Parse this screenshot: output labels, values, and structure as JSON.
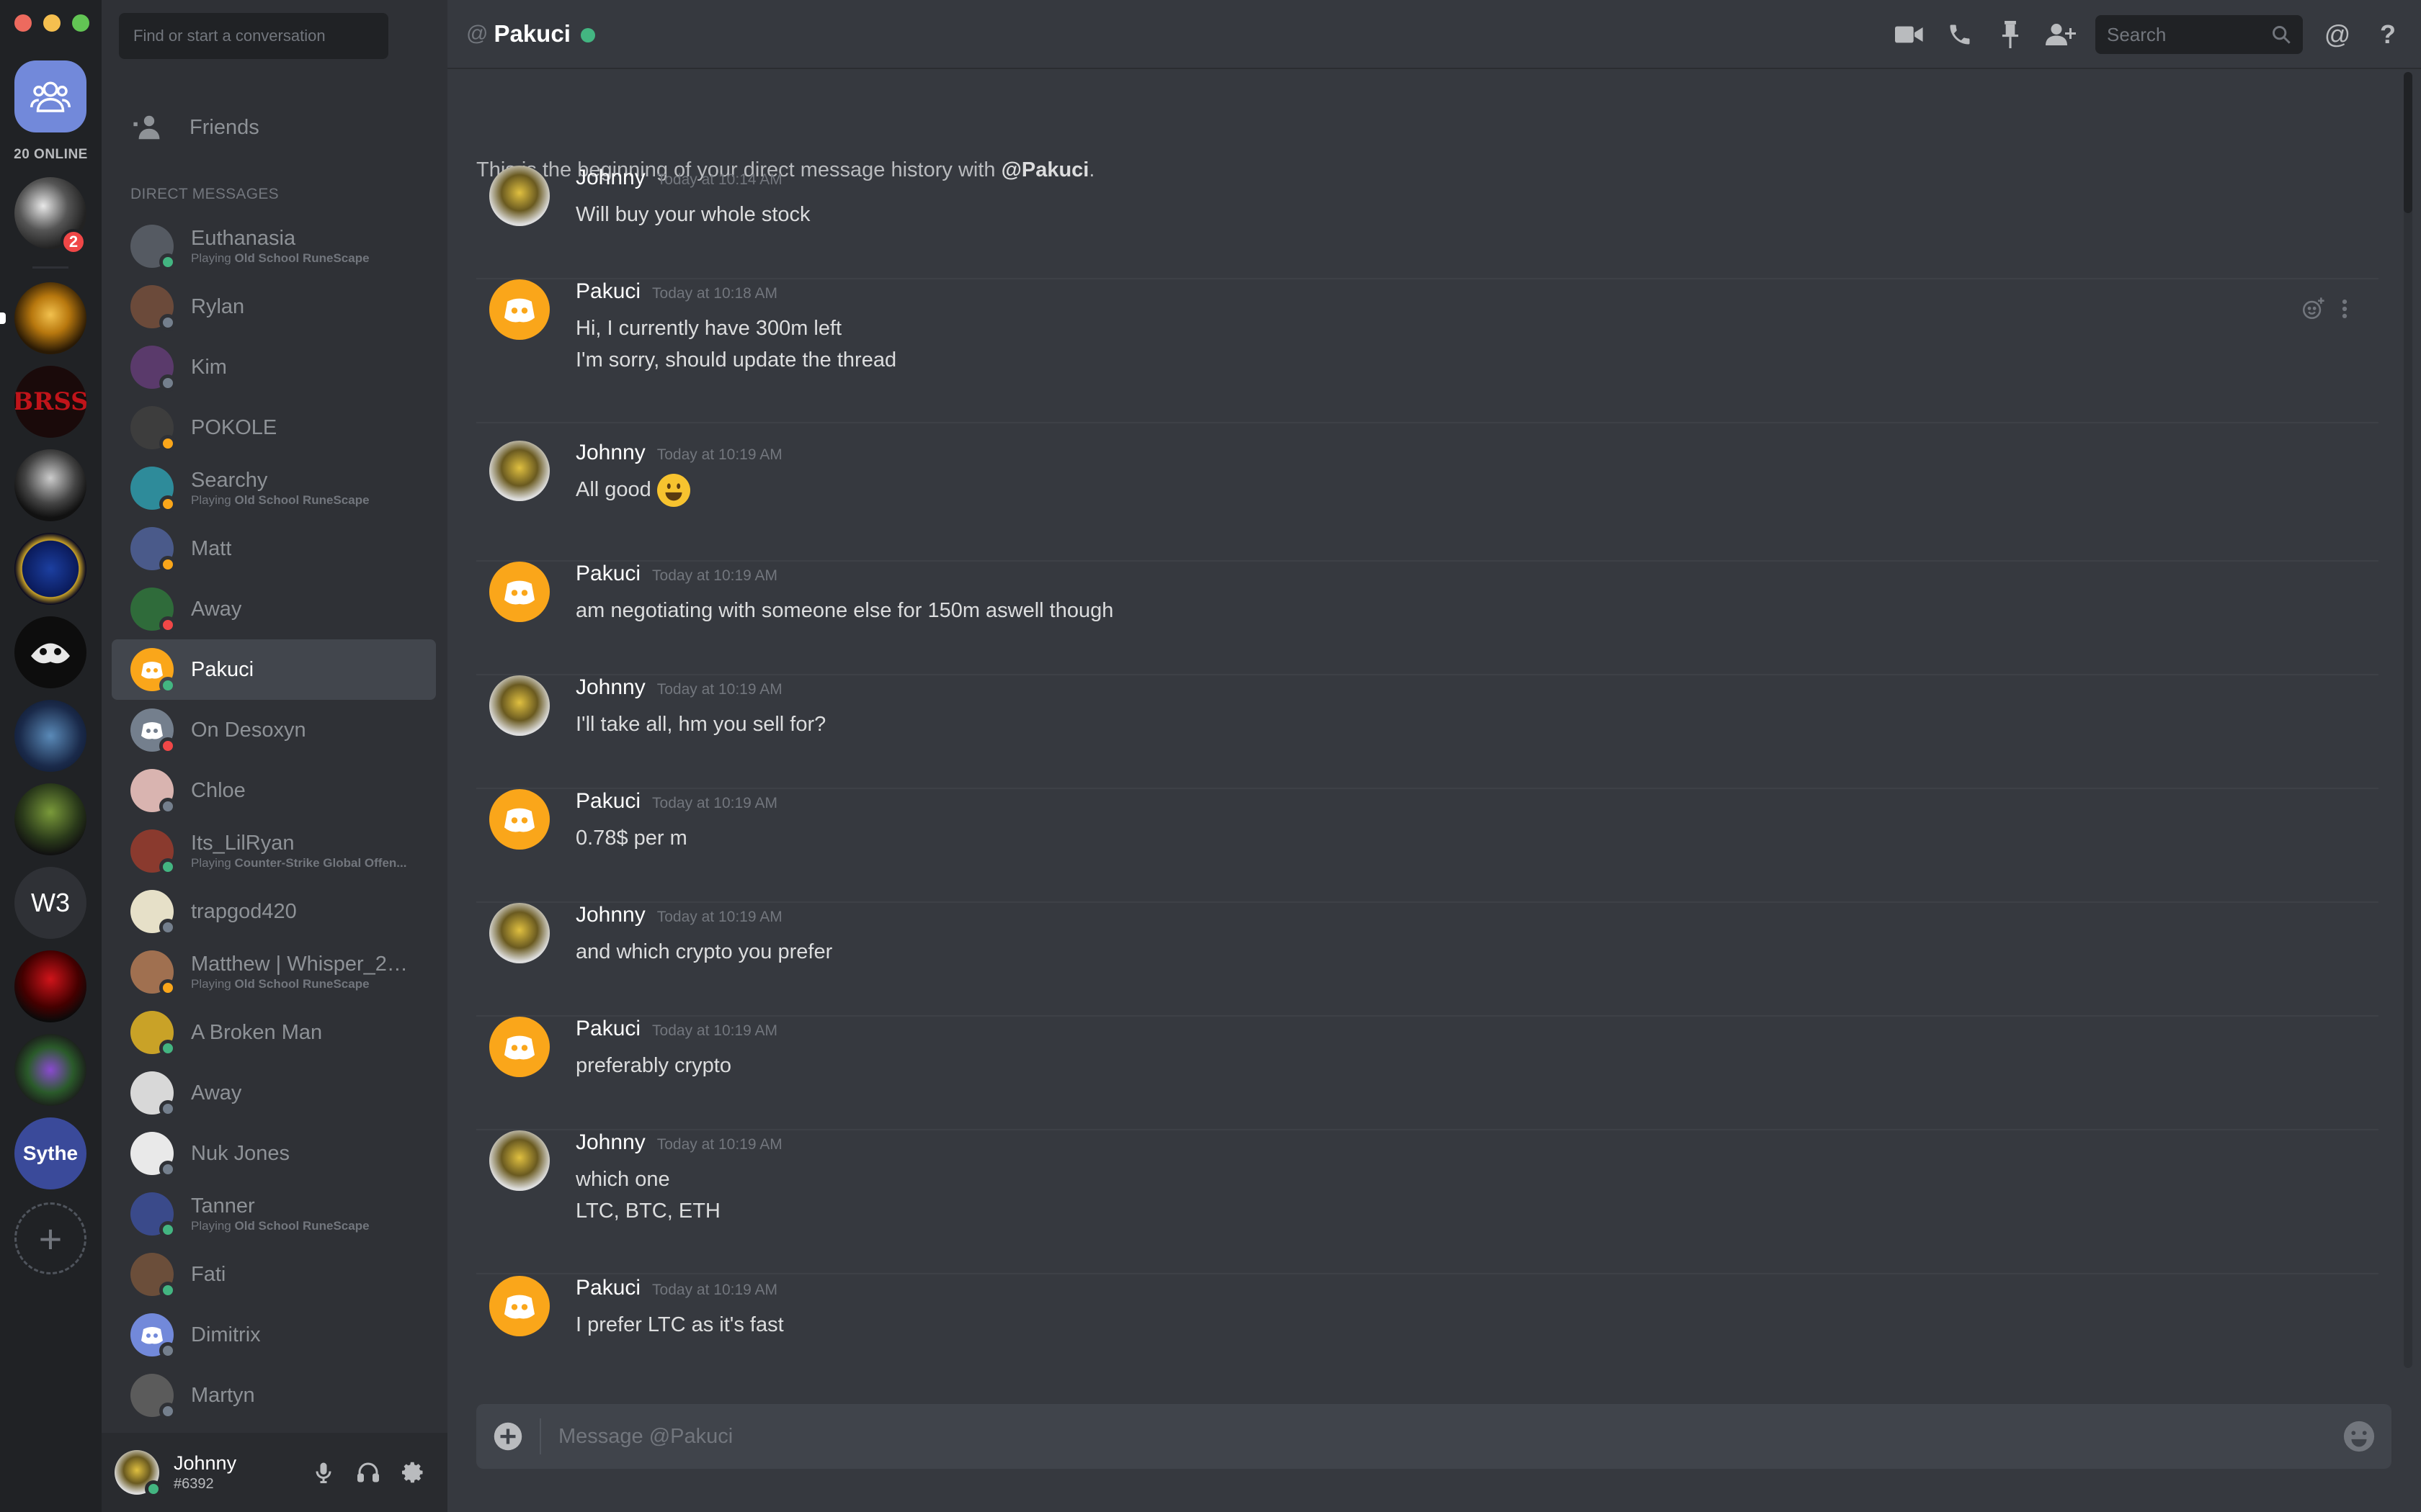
{
  "guilds": {
    "online_count": "20 ONLINE",
    "mention_badge": "2",
    "text_guild_label": "W3",
    "sythe_label": "Sythe"
  },
  "dm_sidebar": {
    "search_placeholder": "Find or start a conversation",
    "friends_label": "Friends",
    "heading": "DIRECT MESSAGES",
    "activity_prefix": "Playing",
    "items": [
      {
        "name": "Euthanasia",
        "activity": "Old School RuneScape",
        "status": "online",
        "avatar_color": "#555a62"
      },
      {
        "name": "Rylan",
        "activity": "",
        "status": "offline",
        "avatar_color": "#6b4a3a"
      },
      {
        "name": "Kim",
        "activity": "",
        "status": "offline",
        "avatar_color": "#5a3a6b"
      },
      {
        "name": "POKOLE",
        "activity": "",
        "status": "idle",
        "avatar_color": "#3d3d3d"
      },
      {
        "name": "Searchy",
        "activity": "Old School RuneScape",
        "status": "idle",
        "avatar_color": "#2e8b9a"
      },
      {
        "name": "Matt",
        "activity": "",
        "status": "idle",
        "avatar_color": "#4a5a8a"
      },
      {
        "name": "Away",
        "activity": "",
        "status": "dnd",
        "avatar_color": "#2f6b3a"
      },
      {
        "name": "Pakuci",
        "activity": "",
        "status": "online",
        "avatar_color": "#faa61a"
      },
      {
        "name": "On Desoxyn",
        "activity": "",
        "status": "dnd",
        "avatar_color": "#747f8d"
      },
      {
        "name": "Chloe",
        "activity": "",
        "status": "offline",
        "avatar_color": "#d9b4b0"
      },
      {
        "name": "Its_LilRyan",
        "activity": "Counter-Strike Global Offen...",
        "status": "online",
        "avatar_color": "#8a3a2e"
      },
      {
        "name": "trapgod420",
        "activity": "",
        "status": "offline",
        "avatar_color": "#e6e0c8"
      },
      {
        "name": "Matthew | Whisper_2_...",
        "activity": "Old School RuneScape",
        "status": "idle",
        "avatar_color": "#a07050"
      },
      {
        "name": "A Broken Man",
        "activity": "",
        "status": "online",
        "avatar_color": "#c9a227"
      },
      {
        "name": "Away",
        "activity": "",
        "status": "offline",
        "avatar_color": "#d8d8d8"
      },
      {
        "name": "Nuk Jones",
        "activity": "",
        "status": "offline",
        "avatar_color": "#e9e9e9"
      },
      {
        "name": "Tanner",
        "activity": "Old School RuneScape",
        "status": "online",
        "avatar_color": "#3a4a8a"
      },
      {
        "name": "Fati",
        "activity": "",
        "status": "online",
        "avatar_color": "#6b4e3a"
      },
      {
        "name": "Dimitrix",
        "activity": "",
        "status": "offline",
        "avatar_color": "#7289da"
      },
      {
        "name": "Martyn",
        "activity": "",
        "status": "offline",
        "avatar_color": "#5b5b5b"
      }
    ]
  },
  "user_panel": {
    "name": "Johnny",
    "tag": "#6392"
  },
  "header": {
    "at_symbol": "@",
    "name": "Pakuci",
    "search_placeholder": "Search",
    "mention_symbol": "@",
    "help_symbol": "?"
  },
  "chat": {
    "intro_prefix": "This is the beginning of your direct message history with",
    "intro_user": "@Pakuci",
    "intro_suffix": ".",
    "messages": [
      {
        "author": "Johnny",
        "time": "Today at 10:14 AM",
        "lines": [
          "Will buy your whole stock"
        ],
        "emoji": false
      },
      {
        "author": "Pakuci",
        "time": "Today at 10:18 AM",
        "lines": [
          "Hi, I currently have 300m left",
          "I'm sorry, should update the thread"
        ],
        "emoji": false
      },
      {
        "author": "Johnny",
        "time": "Today at 10:19 AM",
        "lines": [
          "All good"
        ],
        "emoji": true
      },
      {
        "author": "Pakuci",
        "time": "Today at 10:19 AM",
        "lines": [
          "am negotiating with someone else for 150m aswell though"
        ],
        "emoji": false
      },
      {
        "author": "Johnny",
        "time": "Today at 10:19 AM",
        "lines": [
          "I'll take all, hm you sell for?"
        ],
        "emoji": false
      },
      {
        "author": "Pakuci",
        "time": "Today at 10:19 AM",
        "lines": [
          "0.78$ per m"
        ],
        "emoji": false
      },
      {
        "author": "Johnny",
        "time": "Today at 10:19 AM",
        "lines": [
          "and which crypto you prefer"
        ],
        "emoji": false
      },
      {
        "author": "Pakuci",
        "time": "Today at 10:19 AM",
        "lines": [
          "preferably crypto"
        ],
        "emoji": false
      },
      {
        "author": "Johnny",
        "time": "Today at 10:19 AM",
        "lines": [
          "which one",
          "LTC, BTC, ETH"
        ],
        "emoji": false
      },
      {
        "author": "Pakuci",
        "time": "Today at 10:19 AM",
        "lines": [
          "I prefer LTC as it's fast"
        ],
        "emoji": false
      }
    ]
  },
  "composer": {
    "placeholder": "Message @Pakuci"
  },
  "colors": {
    "online": "#43b581",
    "idle": "#faa61a",
    "dnd": "#f04747",
    "offline": "#747f8d",
    "blurple": "#7289da",
    "pakuci_avatar": "#faa61a"
  }
}
